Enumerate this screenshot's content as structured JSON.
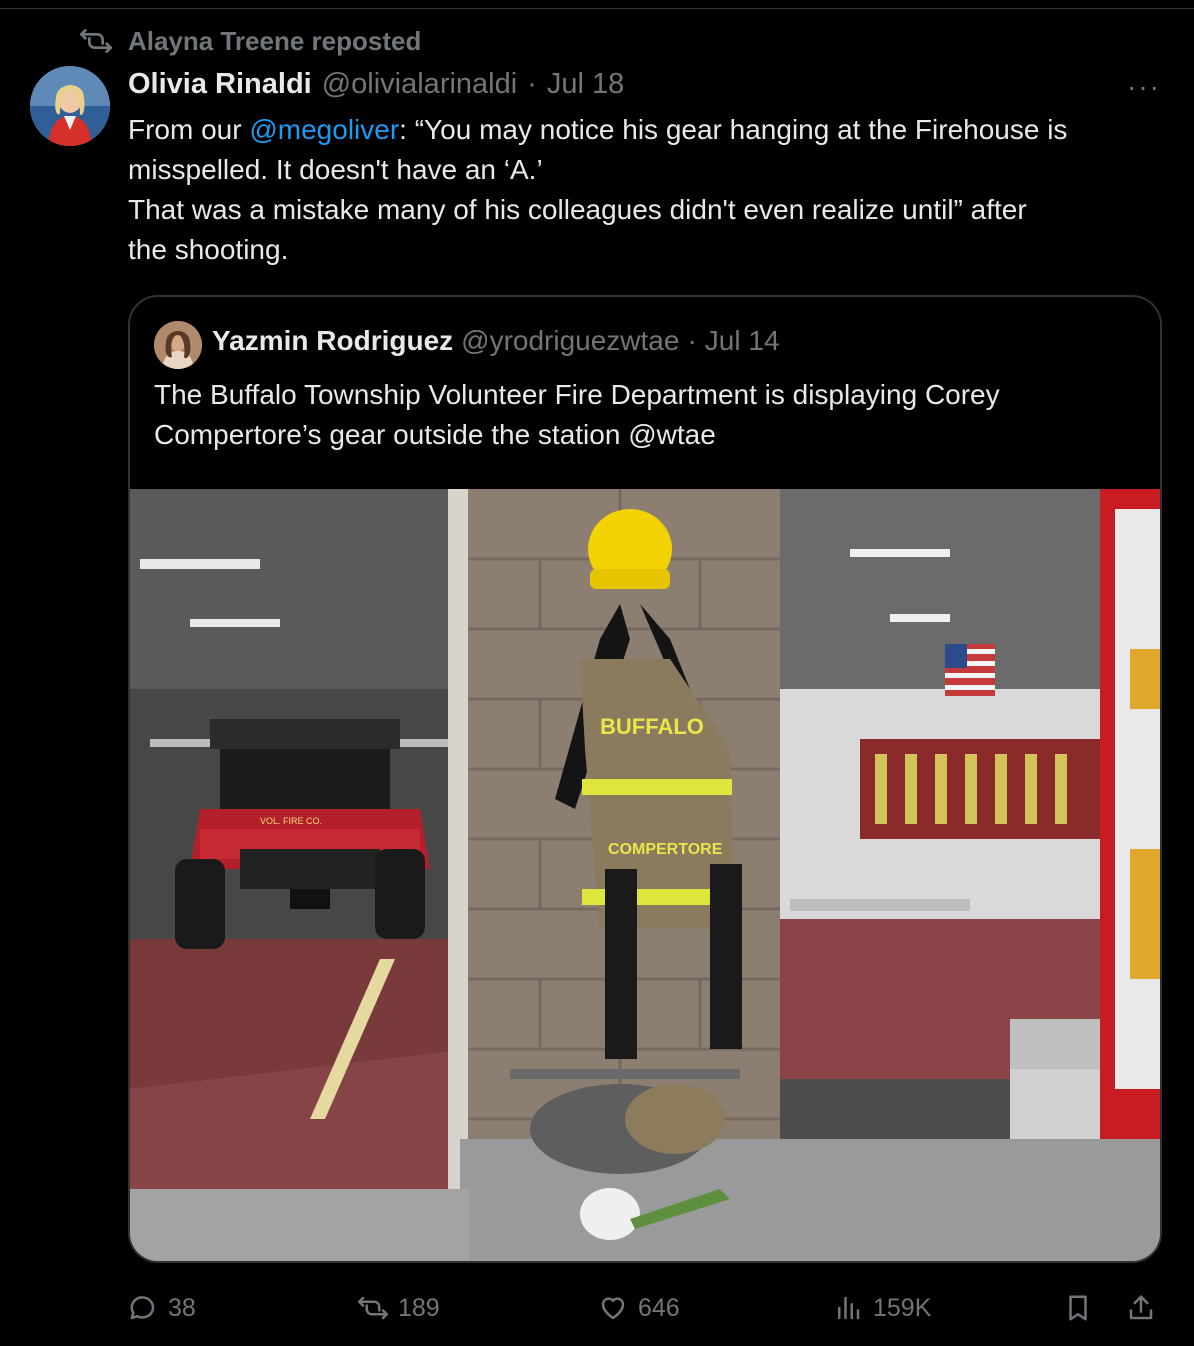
{
  "repost": {
    "text": "Alayna Treene reposted"
  },
  "tweet": {
    "author_name": "Olivia Rinaldi",
    "handle": "@olivialarinaldi",
    "separator": "·",
    "date": "Jul 18",
    "more_label": "···",
    "text_parts": {
      "line1_pre": "From our ",
      "mention": "@megoliver",
      "line1_post": ": “You may notice his gear hanging at the Firehouse is",
      "line2": "misspelled. It doesn't have an ‘A.’",
      "line3": "That was a mistake many of his colleagues didn't even realize until” after",
      "line4": "the shooting."
    }
  },
  "quote": {
    "author_name": "Yazmin Rodriguez",
    "handle": "@yrodriguezwtae",
    "separator": "·",
    "date": "Jul 14",
    "text_line1": "The Buffalo Township Volunteer Fire Department is displaying Corey",
    "text_line2": "Compertore’s gear outside the station @wtae",
    "photo": {
      "jacket_text_top": "BUFFALO",
      "jacket_text_bottom": "COMPERTORE",
      "vehicle_text": "VOL. FIRE CO."
    }
  },
  "actions": {
    "replies": "38",
    "reposts": "189",
    "likes": "646",
    "views": "159K"
  },
  "colors": {
    "background": "#000000",
    "text": "#e7e9ea",
    "muted": "#71767b",
    "accent": "#1d9bf0",
    "border": "#2f3336"
  }
}
